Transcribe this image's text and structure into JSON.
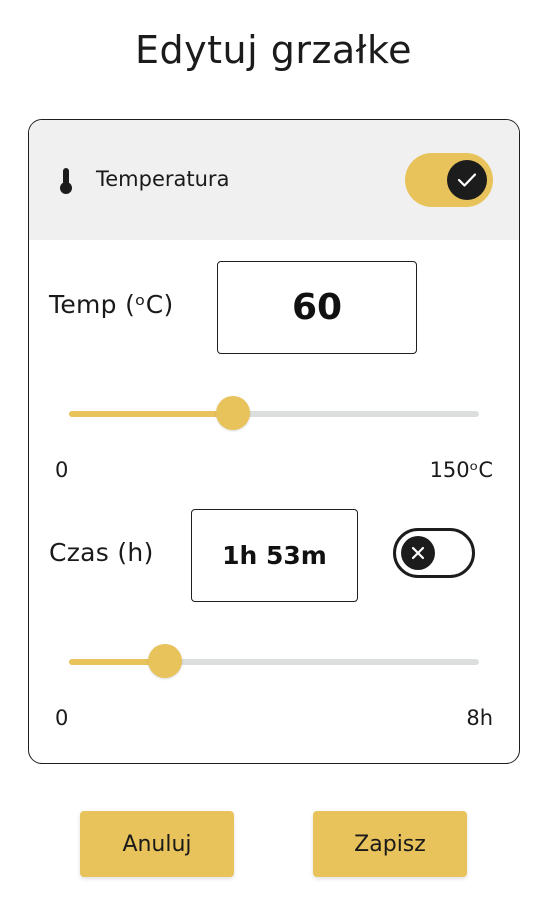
{
  "title": "Edytuj grzałke",
  "temperature_section": {
    "header_label": "Temperatura",
    "header_icon": "thermometer-icon",
    "enabled": true,
    "temp_label": "Temp (ᵒC)",
    "temp_value": "60",
    "temp_slider": {
      "min": 0,
      "max": 150,
      "value": 60
    },
    "temp_min_label": "0",
    "temp_max_label": "150ᵒC"
  },
  "time_section": {
    "label": "Czas (h)",
    "value": "1h 53m",
    "enabled": false,
    "time_slider": {
      "min": 0,
      "max": 8,
      "value": 1.88
    },
    "time_min_label": "0",
    "time_max_label": "8h"
  },
  "buttons": {
    "cancel_label": "Anuluj",
    "save_label": "Zapisz"
  },
  "colors": {
    "accent": "#e8c25a",
    "track": "#dcdedd",
    "header_bg": "#f0f0f0",
    "dark": "#1c1c1c"
  }
}
